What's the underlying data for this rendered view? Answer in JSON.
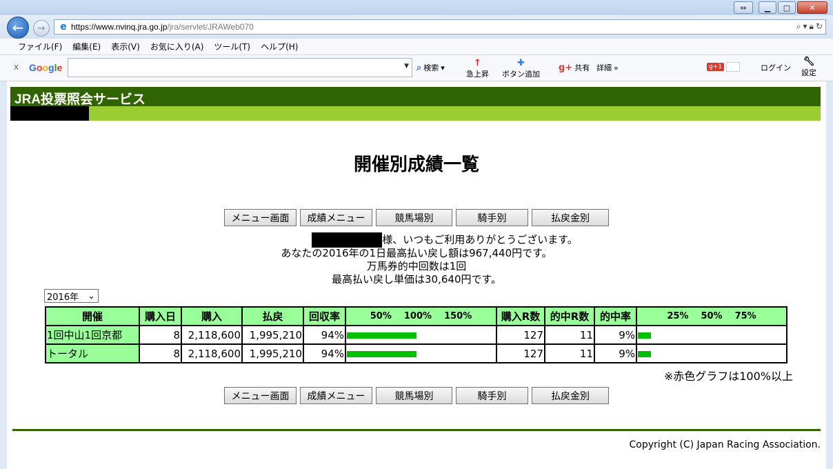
{
  "browser": {
    "url_host": "https://www.nvinq.jra.go.jp",
    "url_path": "/jra/servlet/JRAWeb070",
    "menu": [
      "ファイル(F)",
      "編集(E)",
      "表示(V)",
      "お気に入り(A)",
      "ツール(T)",
      "ヘルプ(H)"
    ],
    "google_toolbar": {
      "logo": "Google",
      "search_label": "検索",
      "rising_label": "急上昇",
      "add_button_label": "ボタン追加",
      "share_label": "共有",
      "details_label": "詳細",
      "login_label": "ログイン",
      "settings_label": "設定"
    }
  },
  "site": {
    "header_title": "JRA投票照会サービス",
    "page_title": "開催別成績一覧"
  },
  "nav_buttons": [
    "メニュー画面",
    "成績メニュー",
    "競馬場別",
    "騎手別",
    "払戻金別"
  ],
  "messages": {
    "greeting": "様、いつもご利用ありがとうございます。",
    "max_payout": "あなたの2016年の1日最高払い戻し額は967,440円です。",
    "hits_count": "万馬券的中回数は1回",
    "max_unit": "最高払い戻し単価は30,640円です。"
  },
  "year_select": {
    "value": "2016年"
  },
  "table": {
    "headers": [
      "開催",
      "購入日",
      "購入",
      "払戻",
      "回収率",
      "50%　100%　150%",
      "購入R数",
      "的中R数",
      "的中率",
      "25%　50%　75%"
    ],
    "recovery_scale": [
      "50%",
      "100%",
      "150%"
    ],
    "hit_scale": [
      "25%",
      "50%",
      "75%"
    ],
    "rows": [
      {
        "name": "1回中山1回京都",
        "days": "8",
        "purchase": "2,118,600",
        "payout": "1,995,210",
        "recovery": "94%",
        "recovery_value": 94,
        "races": "127",
        "hits": "11",
        "hit_rate": "9%",
        "hit_rate_value": 9
      },
      {
        "name": "トータル",
        "days": "8",
        "purchase": "2,118,600",
        "payout": "1,995,210",
        "recovery": "94%",
        "recovery_value": 94,
        "races": "127",
        "hits": "11",
        "hit_rate": "9%",
        "hit_rate_value": 9
      }
    ]
  },
  "note": "※赤色グラフは100%以上",
  "copyright": "Copyright (C) Japan Racing Association."
}
